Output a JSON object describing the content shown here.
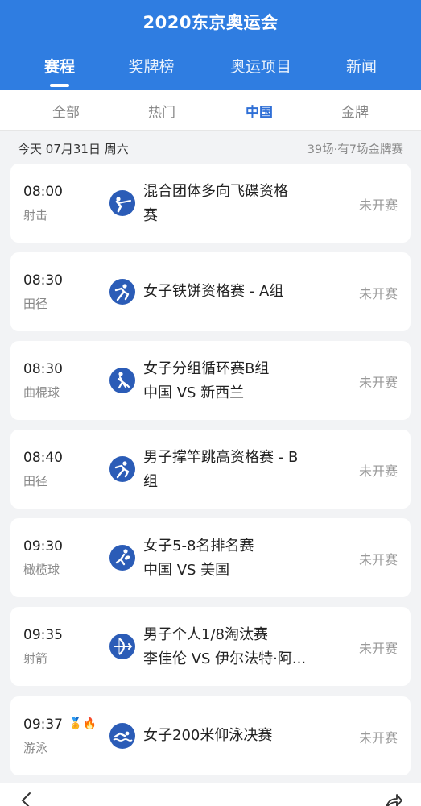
{
  "header": {
    "title": "2020东京奥运会"
  },
  "main_tabs": [
    {
      "label": "赛程",
      "active": true
    },
    {
      "label": "奖牌榜"
    },
    {
      "label": "奥运项目"
    },
    {
      "label": "新闻"
    }
  ],
  "filter_tabs": [
    {
      "label": "全部"
    },
    {
      "label": "热门"
    },
    {
      "label": "中国",
      "active": true
    },
    {
      "label": "金牌"
    }
  ],
  "date_row": {
    "date": "今天 07月31日 周六",
    "summary": "39场·有7场金牌赛"
  },
  "matches": [
    {
      "time": "08:00",
      "sport": "射击",
      "icon": "shooting-icon",
      "title_line1": "混合团体多向飞碟资格",
      "title_line2": "赛",
      "status": "未开赛"
    },
    {
      "time": "08:30",
      "sport": "田径",
      "icon": "athletics-icon",
      "title_line1": "女子铁饼资格赛 - A组",
      "title_line2": "",
      "status": "未开赛"
    },
    {
      "time": "08:30",
      "sport": "曲棍球",
      "icon": "hockey-icon",
      "title_line1": "女子分组循环赛B组",
      "title_line2": "中国  VS  新西兰",
      "status": "未开赛"
    },
    {
      "time": "08:40",
      "sport": "田径",
      "icon": "athletics-icon",
      "title_line1": "男子撑竿跳高资格赛 - B",
      "title_line2": "组",
      "status": "未开赛"
    },
    {
      "time": "09:30",
      "sport": "橄榄球",
      "icon": "rugby-icon",
      "title_line1": "女子5-8名排名赛",
      "title_line2": "中国  VS  美国",
      "status": "未开赛"
    },
    {
      "time": "09:35",
      "sport": "射箭",
      "icon": "archery-icon",
      "title_line1": "男子个人1/8淘汰赛",
      "title_line2": "李佳伦  VS  伊尔法特·阿...",
      "status": "未开赛"
    },
    {
      "time": "09:37",
      "sport": "游泳",
      "icon": "swimming-icon",
      "title_line1": "女子200米仰泳决赛",
      "title_line2": "",
      "status": "未开赛",
      "badges": [
        "gold-medal-icon",
        "fire-icon"
      ]
    }
  ],
  "colors": {
    "header": "#2f7de1",
    "active_filter": "#2f6fd6",
    "icon_bg": "#2b5cb7"
  }
}
